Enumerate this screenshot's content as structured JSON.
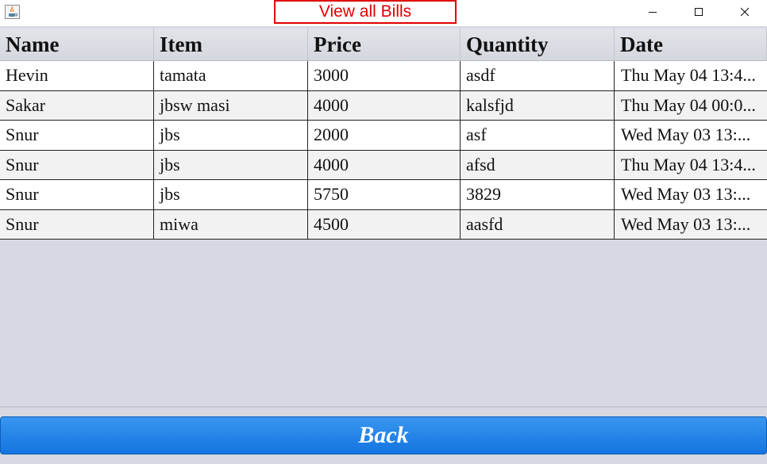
{
  "window": {
    "title": "View all Bills",
    "app_icon": "java-icon",
    "controls": [
      "minimize-icon",
      "maximize-icon",
      "close-icon"
    ]
  },
  "table": {
    "columns": [
      "Name",
      "Item",
      "Price",
      "Quantity",
      "Date"
    ],
    "rows": [
      [
        "Hevin",
        "tamata",
        "3000",
        "asdf",
        "Thu May 04 13:4..."
      ],
      [
        "Sakar",
        "jbsw masi",
        "4000",
        "kalsfjd",
        "Thu May 04 00:0..."
      ],
      [
        "Snur",
        "jbs",
        "2000",
        "asf",
        "Wed May 03 13:..."
      ],
      [
        "Snur",
        "jbs",
        "4000",
        "afsd",
        "Thu May 04 13:4..."
      ],
      [
        "Snur",
        "jbs",
        "5750",
        "3829",
        "Wed May 03 13:..."
      ],
      [
        "Snur",
        "miwa",
        "4500",
        "aasfd",
        "Wed May 03 13:..."
      ]
    ]
  },
  "back_button": {
    "label": "Back"
  },
  "colors": {
    "title_accent": "#e00000",
    "button_blue": "#1f82e8",
    "panel_bg": "#d6d9e1"
  }
}
